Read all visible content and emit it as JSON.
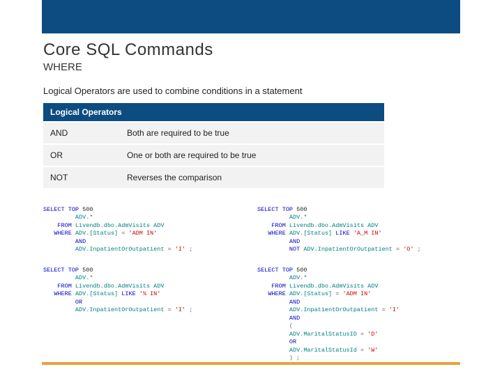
{
  "title": "Core SQL Commands",
  "subtitle": "WHERE",
  "lead": "Logical Operators are used to combine conditions in a statement",
  "table": {
    "header": "Logical Operators",
    "rows": [
      {
        "op": "AND",
        "desc": "Both are required to be true"
      },
      {
        "op": "OR",
        "desc": "One or both are required to be true"
      },
      {
        "op": "NOT",
        "desc": "Reverses the comparison"
      }
    ]
  },
  "code": {
    "kw_select": "SELECT",
    "kw_top": "TOP",
    "kw_from": "FROM",
    "kw_where": "WHERE",
    "kw_and": "AND",
    "kw_or": "OR",
    "kw_not": "NOT",
    "kw_like": "LIKE",
    "top_n": "500",
    "advstar": "ADV.*",
    "from_tbl": "Livendb.dbo.AdmVisits ADV",
    "col_status": "ADV.[Status]",
    "col_inout": "ADV.InpatientOrOutpatient",
    "col_ms": "ADV.MaritalStatusID",
    "col_ms2": "ADV.MaritalStatusId",
    "eq": "=",
    "semi": ";",
    "lp": "(",
    "rp": ")",
    "s_admin": "'ADM IN'",
    "s_am_in": "'A_M IN'",
    "s_pct_in": "'% IN'",
    "s_I": "'I'",
    "s_O": "'O'",
    "s_D": "'D'",
    "s_W": "'W'"
  }
}
